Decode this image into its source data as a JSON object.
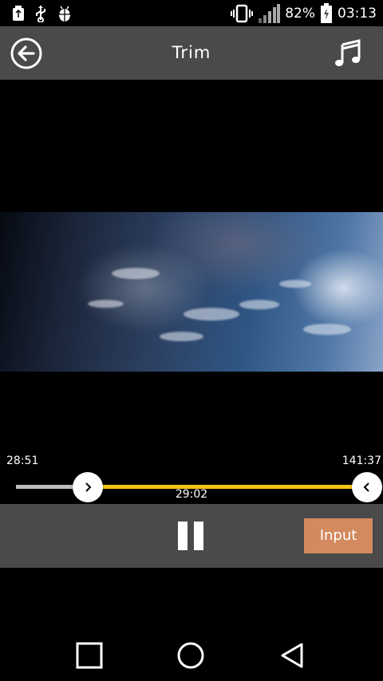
{
  "status_bar": {
    "battery_percent": "82%",
    "time": "03:13",
    "icons": [
      "usb-storage-icon",
      "usb-icon",
      "android-debug-icon",
      "vibrate-icon",
      "signal-icon",
      "battery-charging-icon"
    ]
  },
  "toolbar": {
    "title": "Trim",
    "back_icon": "back-arrow-icon",
    "music_icon": "music-note-icon"
  },
  "trim": {
    "start_time": "28:51",
    "end_time": "141:37",
    "duration": "29:02",
    "start_handle_icon": "chevron-right-icon",
    "end_handle_icon": "chevron-left-icon",
    "accent_color": "#f5c316"
  },
  "controls": {
    "pause_icon": "pause-icon",
    "input_label": "Input",
    "input_color": "#d38a5e"
  },
  "nav_bar": {
    "icons": [
      "recents-icon",
      "home-icon",
      "back-icon"
    ]
  }
}
